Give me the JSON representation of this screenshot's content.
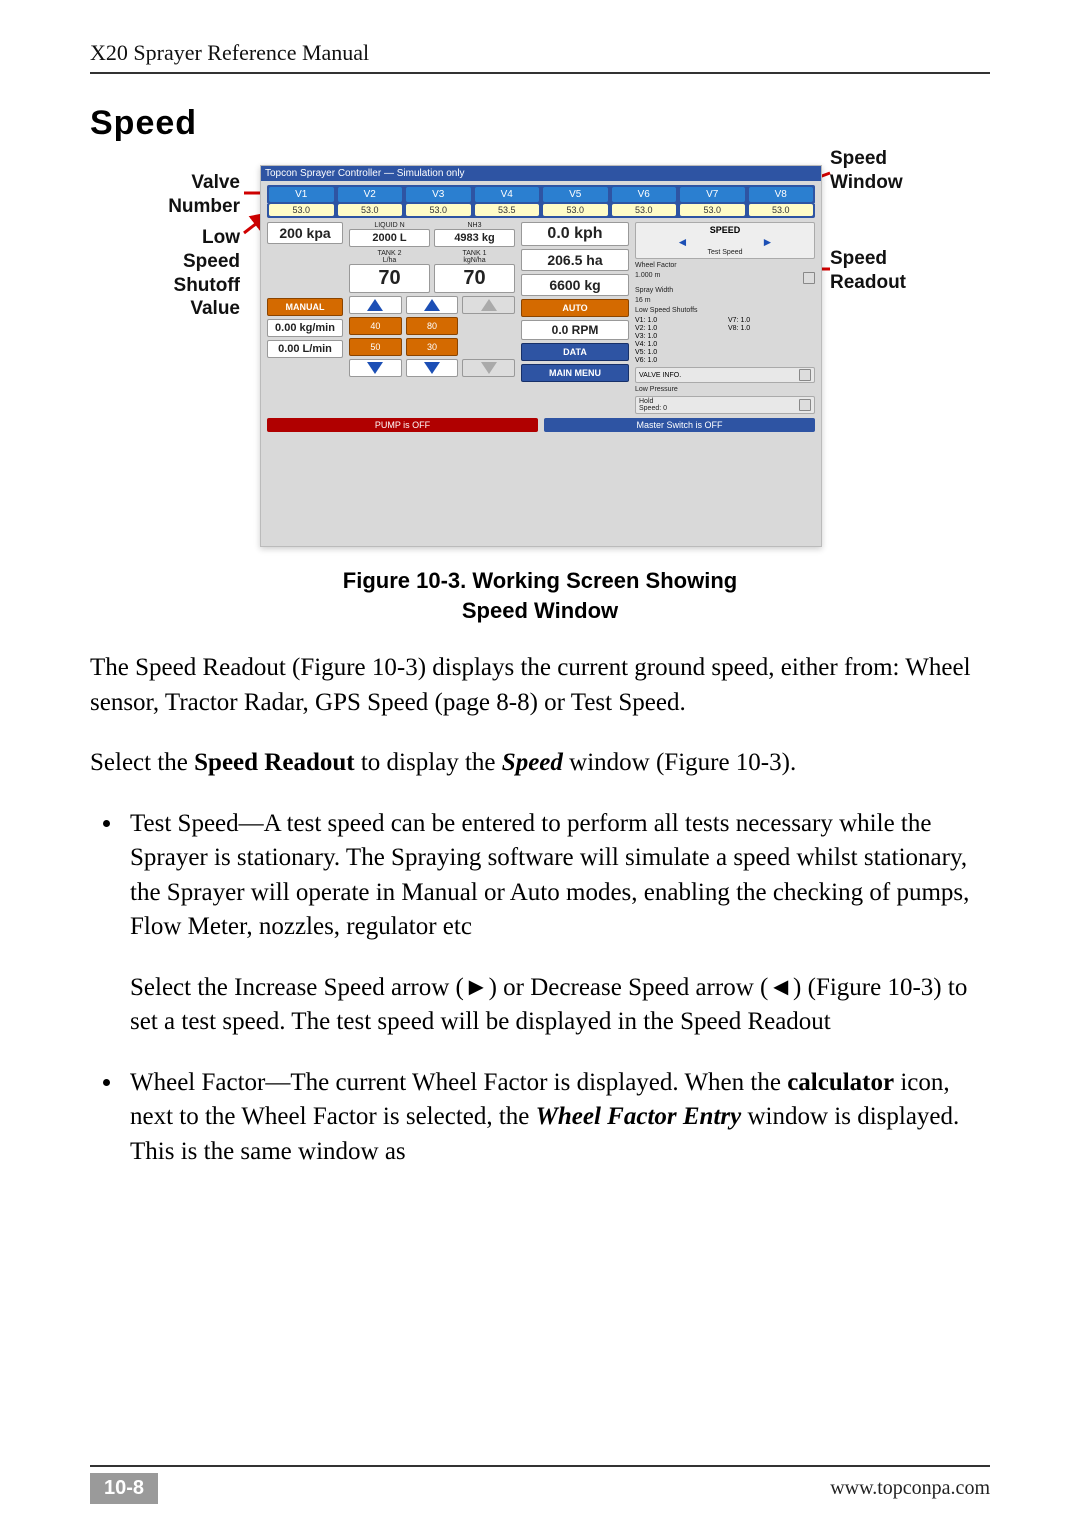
{
  "header": {
    "title": "X20 Sprayer Reference Manual"
  },
  "section_title": "Speed",
  "callouts": {
    "valve_number": "Valve\nNumber",
    "low_speed_shutoff": "Low\nSpeed\nShutoff\nValue",
    "speed_window": "Speed\nWindow",
    "speed_readout": "Speed\nReadout"
  },
  "screenshot": {
    "titlebar": "Topcon Sprayer Controller — Simulation only",
    "valves": [
      "V1",
      "V2",
      "V3",
      "V4",
      "V5",
      "V6",
      "V7",
      "V8"
    ],
    "valve_values": [
      "53.0",
      "53.0",
      "53.0",
      "53.5",
      "53.0",
      "53.0",
      "53.0",
      "53.0"
    ],
    "left": {
      "pressure": "200 kpa",
      "manual_btn": "MANUAL",
      "rate1": "0.00 kg/min",
      "rate2": "0.00 L/min"
    },
    "center": {
      "top_labels": [
        "LIQUID N",
        "NH3"
      ],
      "top_values": [
        "2000 L",
        "4983 kg"
      ],
      "mid_labels": [
        "TANK 2\nL/ha",
        "TANK 1\nkgN/ha"
      ],
      "mid_values": [
        "70",
        "70"
      ],
      "presets": [
        [
          "40",
          "80"
        ],
        [
          "50",
          "30"
        ]
      ]
    },
    "readouts": {
      "speed": "0.0 kph",
      "area": "206.5 ha",
      "weight": "6600 kg",
      "auto_btn": "AUTO",
      "rpm": "0.0 RPM",
      "data_btn": "DATA",
      "mainmenu_btn": "MAIN MENU"
    },
    "side_panel": {
      "speed_header": "SPEED",
      "test_speed_label": "Test Speed",
      "wheel_factor_label": "Wheel Factor",
      "wheel_factor_value": "1.000   m",
      "spray_width_label": "Spray Width",
      "spray_width_value": "16         m",
      "low_speed_shutoff_label": "Low Speed Shutoffs",
      "shutoffs": [
        "V1: 1.0",
        "V7: 1.0",
        "V2: 1.0",
        "V8: 1.0",
        "V3: 1.0",
        "",
        "V4: 1.0",
        "",
        "V5: 1.0",
        "",
        "V6: 1.0",
        ""
      ],
      "valve_info_label": "VALVE INFO.",
      "low_pressure_label": "Low Pressure",
      "hold_label": "Hold",
      "speed0_label": "Speed:   0"
    },
    "status": {
      "pump": "PUMP is OFF",
      "master": "Master Switch is OFF"
    }
  },
  "figure_caption_line1": "Figure 10-3. Working Screen Showing",
  "figure_caption_line2": "Speed Window",
  "para1": "The Speed Readout (Figure 10-3) displays the current ground speed, either from: Wheel sensor, Tractor Radar, GPS Speed (page 8-8) or Test Speed.",
  "para2_pre": "Select the ",
  "para2_b": "Speed Readout",
  "para2_mid": " to display the ",
  "para2_i": "Speed",
  "para2_post": " window (Figure 10-3).",
  "bullet1_main": "Test Speed—A test speed can be entered to perform all tests necessary while the Sprayer is stationary. The Spraying software will simulate a speed whilst stationary, the Sprayer will operate in Manual or Auto modes, enabling the checking of pumps, Flow Meter, nozzles, regulator etc",
  "bullet1_sub": "Select the Increase Speed arrow (►) or Decrease Speed arrow (◄) (Figure 10-3) to set a test speed. The test speed will be displayed in the Speed Readout",
  "bullet2_pre": "Wheel Factor—The current Wheel Factor is displayed. When the ",
  "bullet2_b": "calculator",
  "bullet2_mid": " icon, next to the Wheel Factor is selected, the ",
  "bullet2_i": "Wheel Factor Entry",
  "bullet2_post": " window is displayed. This is the same window as",
  "footer": {
    "page": "10-8",
    "url": "www.topconpa.com"
  }
}
